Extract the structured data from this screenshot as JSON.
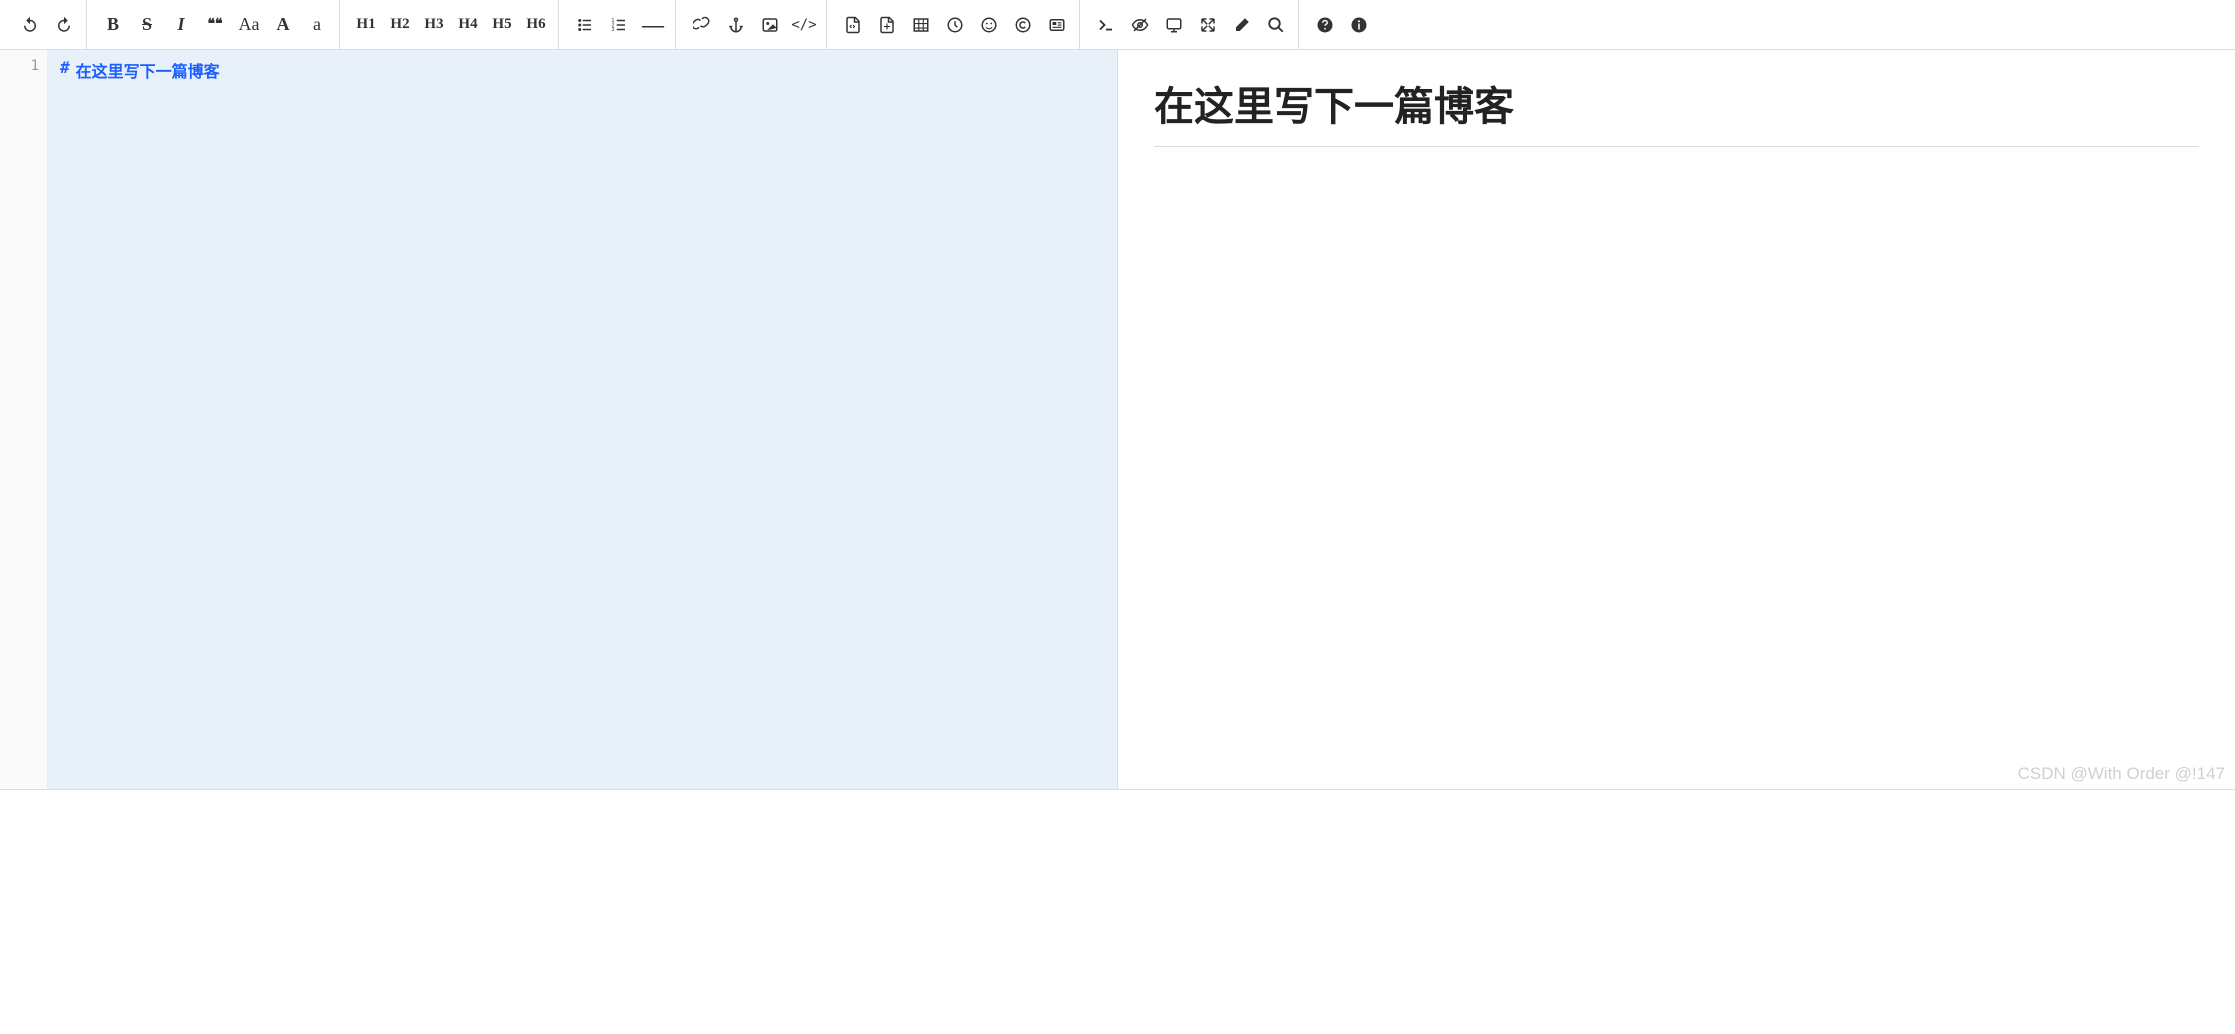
{
  "toolbar": {
    "undo": "undo-icon",
    "redo": "redo-icon",
    "bold": "B",
    "strike": "S",
    "italic": "I",
    "quote": "❝❝",
    "case": "Aa",
    "upper": "A",
    "lower": "a",
    "h1": "H1",
    "h2": "H2",
    "h3": "H3",
    "h4": "H4",
    "h5": "H5",
    "h6": "H6",
    "ul": "ul-icon",
    "ol": "ol-icon",
    "hr": "—",
    "link": "link-icon",
    "anchor": "anchor-icon",
    "image": "image-icon",
    "code": "</>",
    "doc": "doc-icon",
    "pdf": "pdf-icon",
    "table": "table-icon",
    "clock": "clock-icon",
    "emoji": "emoji-icon",
    "copyright": "copyright-icon",
    "card": "card-icon",
    "terminal": "terminal-icon",
    "visibility": "visibility-icon",
    "monitor": "monitor-icon",
    "expand": "expand-icon",
    "erase": "erase-icon",
    "search": "search-icon",
    "help": "help-icon",
    "info": "info-icon"
  },
  "editor": {
    "lineNumber": "1",
    "hashMark": "#",
    "lineText": "在这里写下一篇博客"
  },
  "preview": {
    "heading": "在这里写下一篇博客"
  },
  "watermark": "CSDN @With Order @!147"
}
